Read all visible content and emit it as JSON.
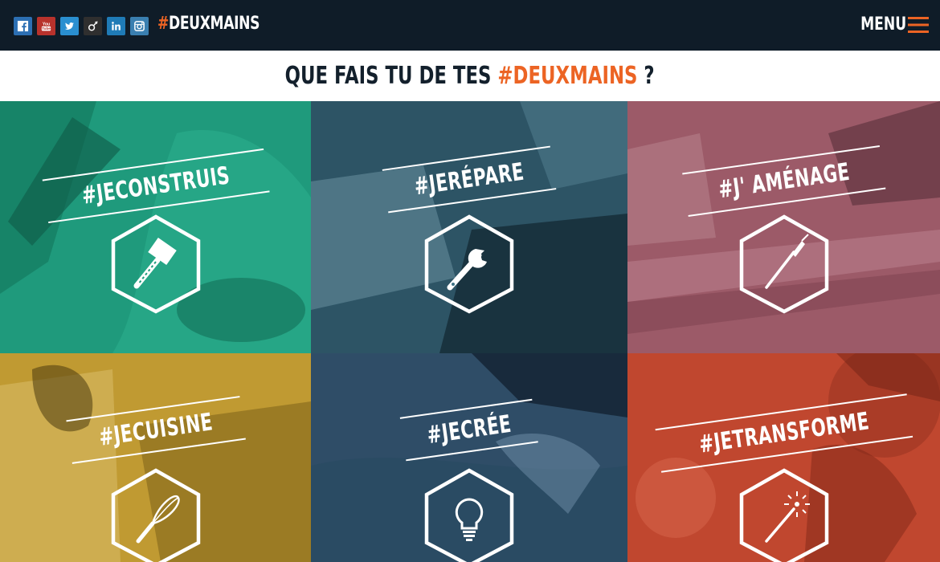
{
  "header": {
    "socials": [
      {
        "name": "facebook",
        "glyph": "f",
        "color": "#2c6fb3"
      },
      {
        "name": "youtube",
        "glyph": "You Tube",
        "color": "#b8322c"
      },
      {
        "name": "twitter",
        "glyph": "t",
        "color": "#2a8fd0"
      },
      {
        "name": "viadeo",
        "glyph": "v",
        "color": "#2f2f2f"
      },
      {
        "name": "linkedin",
        "glyph": "in",
        "color": "#1f7bb6"
      },
      {
        "name": "instagram",
        "glyph": "ig",
        "color": "#3a7fb0"
      }
    ],
    "brand_hash": "#",
    "brand_name": "DEUXMAINS",
    "menu_label": "MENU",
    "menu_icon": "hamburger-icon",
    "accent_color": "#ec6424"
  },
  "headline": {
    "prefix": "QUE FAIS TU DE TES",
    "accent": "#DEUXMAINS",
    "suffix": "?"
  },
  "tiles": [
    {
      "label": "#JECONSTRUIS",
      "icon": "mallet-icon",
      "color": "#1f9a7c"
    },
    {
      "label": "#JERÉPARE",
      "icon": "wrench-icon",
      "color": "#3e7286"
    },
    {
      "label": "#J' AMÉNAGE",
      "icon": "paintbrush-icon",
      "color": "#9c5a68"
    },
    {
      "label": "#JECUISINE",
      "icon": "whisk-icon",
      "color": "#c09a32"
    },
    {
      "label": "#JECRÉE",
      "icon": "lightbulb-icon",
      "color": "#3f6584"
    },
    {
      "label": "#JETRANSFORME",
      "icon": "magic-wand-icon",
      "color": "#c0472f"
    }
  ]
}
